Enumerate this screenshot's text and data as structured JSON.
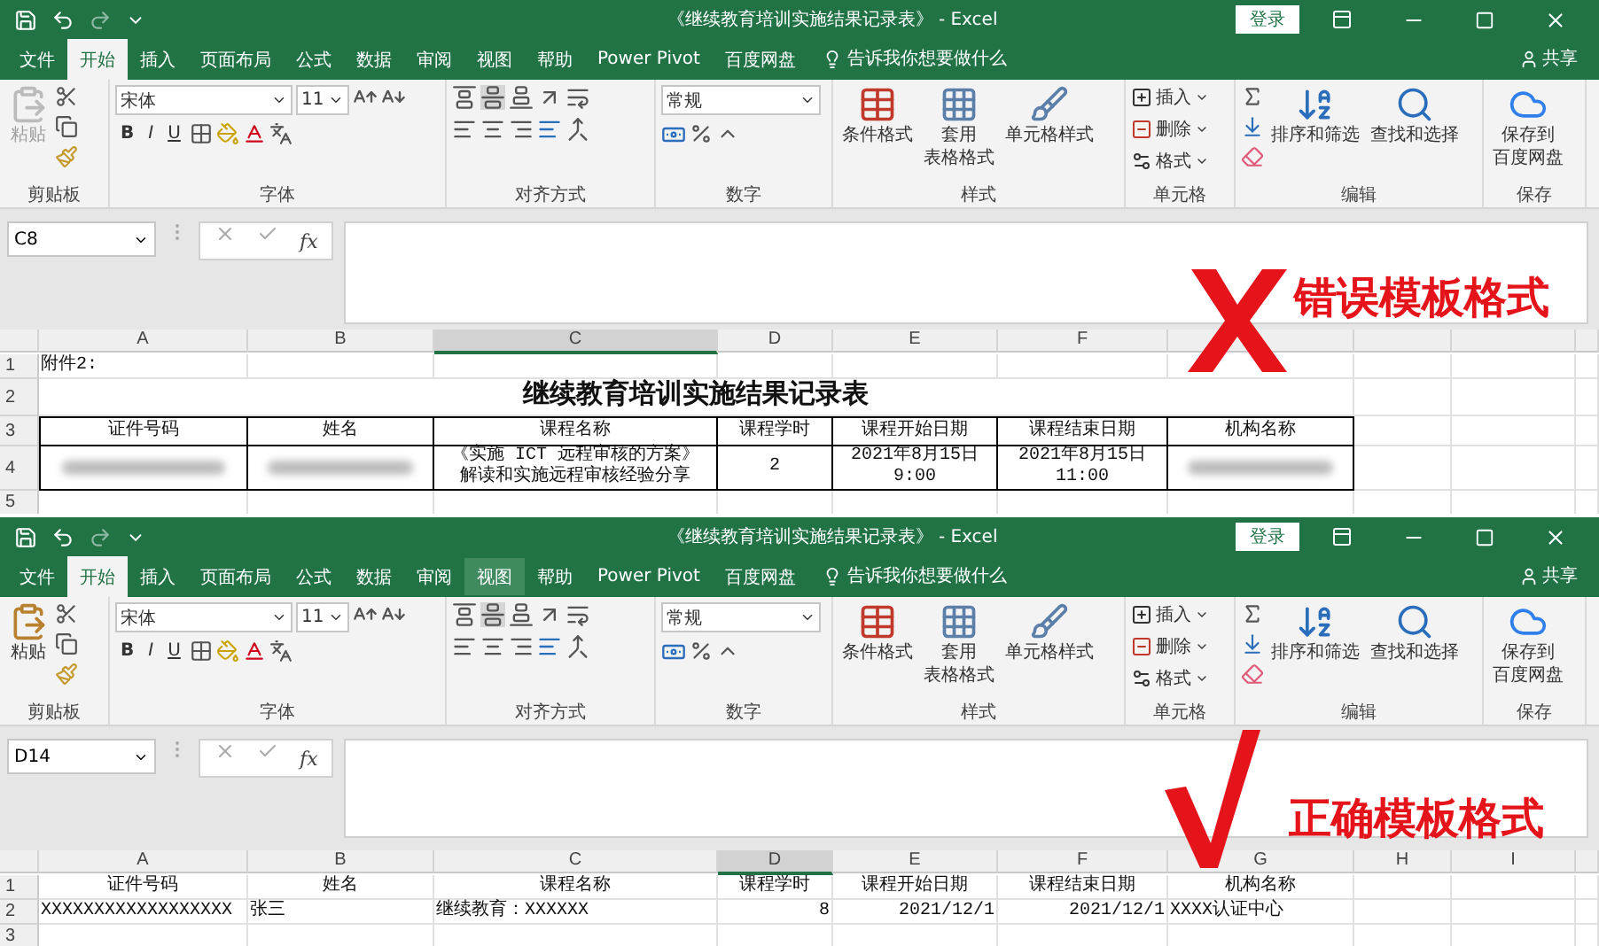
{
  "windows": [
    {
      "title": "《继续教育培训实施结果记录表》 - Excel",
      "login": "登录",
      "tabs": [
        {
          "label": "文件",
          "selected": false,
          "hovered": false
        },
        {
          "label": "开始",
          "selected": true,
          "hovered": false
        },
        {
          "label": "插入",
          "selected": false,
          "hovered": false
        },
        {
          "label": "页面布局",
          "selected": false,
          "hovered": false
        },
        {
          "label": "公式",
          "selected": false,
          "hovered": false
        },
        {
          "label": "数据",
          "selected": false,
          "hovered": false
        },
        {
          "label": "审阅",
          "selected": false,
          "hovered": false
        },
        {
          "label": "视图",
          "selected": false,
          "hovered": false
        },
        {
          "label": "帮助",
          "selected": false,
          "hovered": false
        },
        {
          "label": "Power Pivot",
          "selected": false,
          "hovered": false
        },
        {
          "label": "百度网盘",
          "selected": false,
          "hovered": false
        }
      ],
      "tell_me": "告诉我你想要做什么",
      "share": "共享",
      "ribbon": [
        {
          "kind": "clipboard",
          "label": "剪贴板",
          "paste": "粘贴",
          "paste_disabled": true
        },
        {
          "kind": "font",
          "label": "字体",
          "font": "宋体",
          "size": "11",
          "styles": [
            "B",
            "I",
            "U"
          ]
        },
        {
          "kind": "alignment",
          "label": "对齐方式"
        },
        {
          "kind": "number",
          "label": "数字",
          "format": "常规"
        },
        {
          "kind": "styles",
          "label": "样式",
          "buttons": [
            [
              "条件格式"
            ],
            [
              "套用",
              "表格格式"
            ],
            [
              "单元格样式"
            ]
          ]
        },
        {
          "kind": "cells",
          "label": "单元格",
          "buttons": [
            "插入",
            "删除",
            "格式"
          ]
        },
        {
          "kind": "editing",
          "label": "编辑",
          "buttons": [
            "排序和筛选",
            "查找和选择"
          ]
        },
        {
          "kind": "save",
          "label": "保存",
          "button": [
            "保存到",
            "百度网盘"
          ]
        }
      ],
      "name_box": "C8",
      "function_label": "fx",
      "sheet": {
        "columns": [
          {
            "letter": "A",
            "selected": false
          },
          {
            "letter": "B",
            "selected": false
          },
          {
            "letter": "C",
            "selected": true
          },
          {
            "letter": "D",
            "selected": false
          },
          {
            "letter": "E",
            "selected": false
          },
          {
            "letter": "F",
            "selected": false
          }
        ],
        "rows": [
          {
            "number": "1",
            "kind": "plain",
            "cells": [
              {
                "kind": "text",
                "lines": [
                  "附件2:"
                ]
              }
            ]
          },
          {
            "number": "2",
            "kind": "title",
            "cells": [
              {
                "kind": "text",
                "lines": [
                  "继续教育培训实施结果记录表"
                ]
              }
            ]
          },
          {
            "number": "3",
            "kind": "boxed",
            "cells": [
              {
                "kind": "text",
                "lines": [
                  "证件号码"
                ]
              },
              {
                "kind": "text",
                "lines": [
                  "姓名"
                ]
              },
              {
                "kind": "text",
                "lines": [
                  "课程名称"
                ]
              },
              {
                "kind": "text",
                "lines": [
                  "课程学时"
                ]
              },
              {
                "kind": "text",
                "lines": [
                  "课程开始日期"
                ]
              },
              {
                "kind": "text",
                "lines": [
                  "课程结束日期"
                ]
              },
              {
                "kind": "text",
                "lines": [
                  "机构名称"
                ]
              }
            ]
          },
          {
            "number": "4",
            "kind": "boxed",
            "cells": [
              {
                "kind": "redacted"
              },
              {
                "kind": "redacted"
              },
              {
                "kind": "text",
                "lines": [
                  "《实施 ICT 远程审核的方案》",
                  "解读和实施远程审核经验分享"
                ]
              },
              {
                "kind": "number",
                "lines": [
                  "2"
                ]
              },
              {
                "kind": "text",
                "lines": [
                  "2021年8月15日",
                  "9:00"
                ]
              },
              {
                "kind": "text",
                "lines": [
                  "2021年8月15日",
                  "11:00"
                ]
              },
              {
                "kind": "redacted"
              }
            ]
          },
          {
            "number": "5",
            "kind": "plain"
          }
        ]
      },
      "annotation": {
        "kind": "wrong",
        "text": "错误模板格式"
      }
    },
    {
      "title": "《继续教育培训实施结果记录表》 - Excel",
      "login": "登录",
      "tabs": [
        {
          "label": "文件",
          "selected": false,
          "hovered": false
        },
        {
          "label": "开始",
          "selected": true,
          "hovered": false
        },
        {
          "label": "插入",
          "selected": false,
          "hovered": false
        },
        {
          "label": "页面布局",
          "selected": false,
          "hovered": false
        },
        {
          "label": "公式",
          "selected": false,
          "hovered": false
        },
        {
          "label": "数据",
          "selected": false,
          "hovered": false
        },
        {
          "label": "审阅",
          "selected": false,
          "hovered": false
        },
        {
          "label": "视图",
          "selected": false,
          "hovered": true
        },
        {
          "label": "帮助",
          "selected": false,
          "hovered": false
        },
        {
          "label": "Power Pivot",
          "selected": false,
          "hovered": false
        },
        {
          "label": "百度网盘",
          "selected": false,
          "hovered": false
        }
      ],
      "tell_me": "告诉我你想要做什么",
      "share": "共享",
      "ribbon": [
        {
          "kind": "clipboard",
          "label": "剪贴板",
          "paste": "粘贴",
          "paste_disabled": false
        },
        {
          "kind": "font",
          "label": "字体",
          "font": "宋体",
          "size": "11",
          "styles": [
            "B",
            "I",
            "U"
          ]
        },
        {
          "kind": "alignment",
          "label": "对齐方式"
        },
        {
          "kind": "number",
          "label": "数字",
          "format": "常规"
        },
        {
          "kind": "styles",
          "label": "样式",
          "buttons": [
            [
              "条件格式"
            ],
            [
              "套用",
              "表格格式"
            ],
            [
              "单元格样式"
            ]
          ]
        },
        {
          "kind": "cells",
          "label": "单元格",
          "buttons": [
            "插入",
            "删除",
            "格式"
          ]
        },
        {
          "kind": "editing",
          "label": "编辑",
          "buttons": [
            "排序和筛选",
            "查找和选择"
          ]
        },
        {
          "kind": "save",
          "label": "保存",
          "button": [
            "保存到",
            "百度网盘"
          ]
        }
      ],
      "name_box": "D14",
      "function_label": "fx",
      "sheet": {
        "columns": [
          {
            "letter": "A",
            "selected": false
          },
          {
            "letter": "B",
            "selected": false
          },
          {
            "letter": "C",
            "selected": false
          },
          {
            "letter": "D",
            "selected": true
          },
          {
            "letter": "E",
            "selected": false
          },
          {
            "letter": "F",
            "selected": false
          },
          {
            "letter": "G",
            "selected": false
          },
          {
            "letter": "H",
            "selected": false
          },
          {
            "letter": "I",
            "selected": false
          }
        ],
        "rows": [
          {
            "number": "1",
            "kind": "header",
            "cells": [
              {
                "kind": "text",
                "lines": [
                  "证件号码"
                ]
              },
              {
                "kind": "text",
                "lines": [
                  "姓名"
                ]
              },
              {
                "kind": "text",
                "lines": [
                  "课程名称"
                ]
              },
              {
                "kind": "text",
                "lines": [
                  "课程学时"
                ]
              },
              {
                "kind": "text",
                "lines": [
                  "课程开始日期"
                ]
              },
              {
                "kind": "text",
                "lines": [
                  "课程结束日期"
                ]
              },
              {
                "kind": "text",
                "lines": [
                  "机构名称"
                ]
              }
            ]
          },
          {
            "number": "2",
            "kind": "plain",
            "cells": [
              {
                "kind": "text",
                "lines": [
                  "XXXXXXXXXXXXXXXXXX"
                ]
              },
              {
                "kind": "text",
                "lines": [
                  "张三"
                ]
              },
              {
                "kind": "text",
                "lines": [
                  "继续教育：XXXXXX"
                ]
              },
              {
                "kind": "number",
                "lines": [
                  "8"
                ]
              },
              {
                "kind": "number",
                "lines": [
                  "2021/12/1"
                ]
              },
              {
                "kind": "number",
                "lines": [
                  "2021/12/1"
                ]
              },
              {
                "kind": "text",
                "lines": [
                  "XXXX认证中心"
                ]
              }
            ]
          },
          {
            "number": "3",
            "kind": "plain"
          }
        ]
      },
      "annotation": {
        "kind": "correct",
        "text": "正确模板格式"
      }
    }
  ]
}
